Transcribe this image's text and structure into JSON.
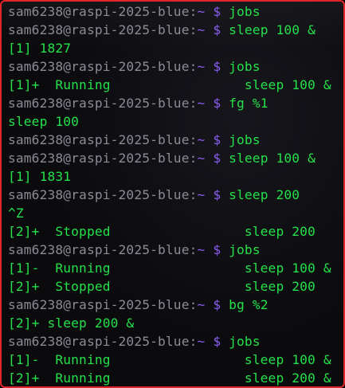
{
  "terminal": {
    "prompt_host": "sam6238@raspi-2025-blue:",
    "prompt_tilde": "~",
    "prompt_dollar": "$",
    "lines": [
      {
        "type": "prompt",
        "cmd": "jobs"
      },
      {
        "type": "prompt",
        "cmd": "sleep 100 &"
      },
      {
        "type": "output",
        "text": "[1] 1827"
      },
      {
        "type": "prompt",
        "cmd": "jobs"
      },
      {
        "type": "output",
        "text": "[1]+  Running                 sleep 100 &"
      },
      {
        "type": "prompt",
        "cmd": "fg %1"
      },
      {
        "type": "output",
        "text": "sleep 100"
      },
      {
        "type": "prompt",
        "cmd": "jobs"
      },
      {
        "type": "prompt",
        "cmd": "sleep 100 &"
      },
      {
        "type": "output",
        "text": "[1] 1831"
      },
      {
        "type": "prompt",
        "cmd": "sleep 200"
      },
      {
        "type": "output",
        "text": "^Z"
      },
      {
        "type": "output",
        "text": "[2]+  Stopped                 sleep 200"
      },
      {
        "type": "prompt",
        "cmd": "jobs"
      },
      {
        "type": "output",
        "text": "[1]-  Running                 sleep 100 &"
      },
      {
        "type": "output",
        "text": "[2]+  Stopped                 sleep 200"
      },
      {
        "type": "prompt",
        "cmd": "bg %2"
      },
      {
        "type": "output",
        "text": "[2]+ sleep 200 &"
      },
      {
        "type": "prompt",
        "cmd": "jobs"
      },
      {
        "type": "output",
        "text": "[1]-  Running                 sleep 100 &"
      },
      {
        "type": "output",
        "text": "[2]+  Running                 sleep 200 &"
      }
    ]
  },
  "colors": {
    "border": "#e0262b",
    "background": "#0b0b0e",
    "text_green": "#24e04a",
    "host_gray": "#8b8b95",
    "prompt_purple": "#8a5cf0"
  }
}
